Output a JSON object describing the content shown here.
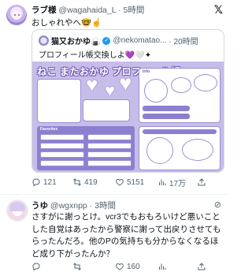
{
  "tweet1": {
    "display_name": "ラブ様",
    "handle": "@wagahaida_L",
    "dot": "·",
    "time": "5時間",
    "text": "おしゃれやへ🤓☝️",
    "x_logo": "𝕏",
    "quote": {
      "display_name": "猫又おかゆ🍙",
      "verified_icon": "✓",
      "handle": "@nekomatao...",
      "time": "· 20時間",
      "text": "プロフィール帳交換しよ💜🤍✦",
      "image": {
        "title": "ねこ またおかゆ プロフィール帳",
        "section_left": "Favorites",
        "section_right": "Info",
        "accent": "#8d7fd0",
        "background": "#c7bde9"
      }
    },
    "actions": {
      "reply_count": "121",
      "retweet_count": "419",
      "like_count": "5151",
      "views_count": "17万"
    }
  },
  "tweet2": {
    "display_name": "うゆ",
    "handle": "@wgxnpp",
    "dot": "·",
    "time": "3時間",
    "reply_icon": "⊘",
    "text": "さすがに謝っとけ。vcr3でもおもろいけど悪いことした自覚はあったから警察に謝って出戻りさせてもらったんだろ。他のPの気持ちも分からなくなるほど成り下がったんか？",
    "actions": {
      "reply_count": "",
      "retweet_count": "",
      "like_count": "160",
      "views_count": ""
    }
  },
  "icons": {
    "reply": "reply-icon",
    "retweet": "retweet-icon",
    "like": "heart-icon",
    "views": "views-icon",
    "share": "share-icon"
  },
  "colors": {
    "text": "#0f1419",
    "secondary": "#536471",
    "verified": "#1d9bf0",
    "border": "#cfd9de"
  }
}
